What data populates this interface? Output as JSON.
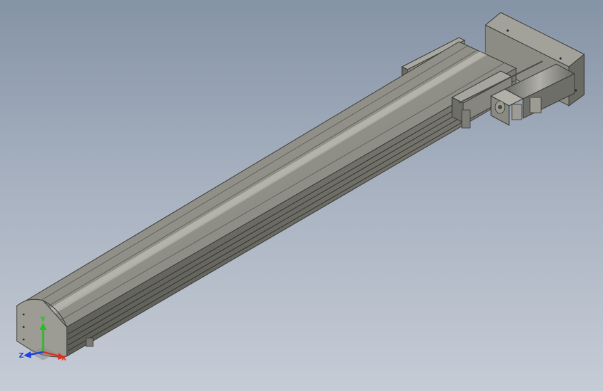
{
  "scene": {
    "background_top": "#8593a6",
    "background_bottom": "#c6ccd6",
    "body_color": "#8c8c84",
    "edge_color": "#3a3a36",
    "light_color": "#b6b6ae",
    "dark_color": "#55554f"
  },
  "triad": {
    "x_label": "X",
    "y_label": "Y",
    "z_label": "Z",
    "x_color": "#e03020",
    "y_color": "#20c020",
    "z_color": "#2040e0"
  }
}
